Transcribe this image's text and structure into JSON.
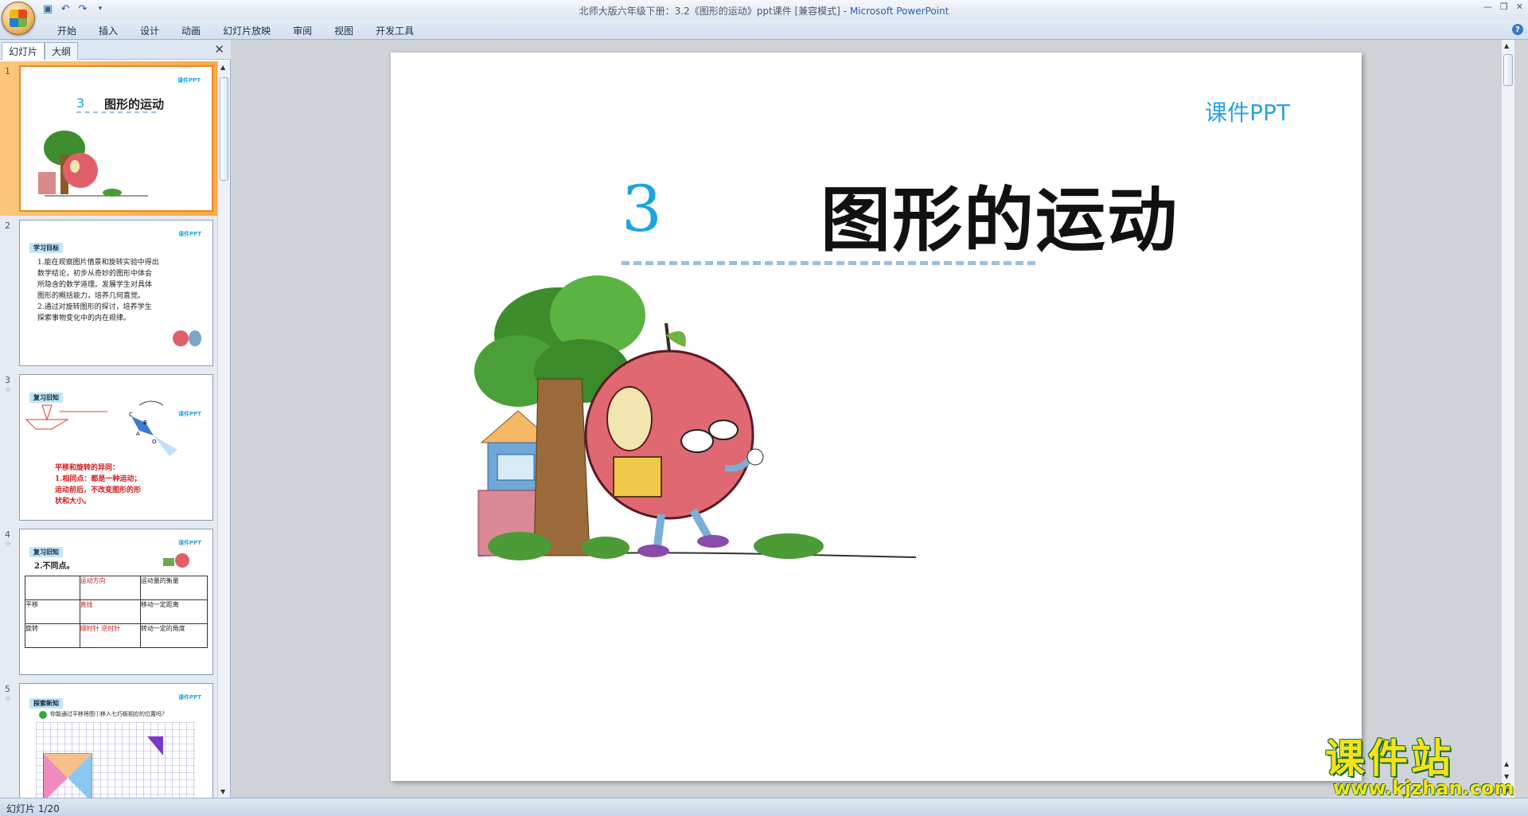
{
  "titlebar": {
    "document_title": "北师大版六年级下册：3.2《图形的运动》ppt课件 [兼容模式] - ",
    "app_name": "Microsoft PowerPoint"
  },
  "ribbon": {
    "tabs": [
      "开始",
      "插入",
      "设计",
      "动画",
      "幻灯片放映",
      "审阅",
      "视图",
      "开发工具"
    ]
  },
  "left_pane": {
    "tab_slides": "幻灯片",
    "tab_outline": "大纲",
    "thumbnails": [
      {
        "number": "1",
        "logo": "课件PPT",
        "num": "3",
        "title": "图形的运动"
      },
      {
        "number": "2",
        "logo": "课件PPT",
        "tag": "学习目标",
        "lines": [
          "1.能在观察图片情景和旋转实验中得出",
          "数学结论，初步从奇妙的图形中体会",
          "所隐含的数学道理。发展学生对具体",
          "图形的概括能力，培养几何直觉。",
          "2.通过对旋转图形的探讨，培养学生",
          "探索事物变化中的内在规律。"
        ]
      },
      {
        "number": "3",
        "logo": "课件PPT",
        "tag": "复习旧知",
        "label_c": "C",
        "label_b": "B",
        "label_a": "A",
        "label_o": "O",
        "red_lines": [
          "平移和旋转的异同：",
          "1.相同点：都是一种运动；",
          "运动前后，不改变图形的形",
          "状和大小。"
        ]
      },
      {
        "number": "4",
        "logo": "课件PPT",
        "tag": "复习旧知",
        "subtitle": "2.不同点。",
        "table": [
          [
            "",
            "运动方向",
            "运动量的衡量"
          ],
          [
            "平移",
            "直线",
            "移动一定距离"
          ],
          [
            "旋转",
            "顺时针 逆时针",
            "转动一定的角度"
          ]
        ]
      },
      {
        "number": "5",
        "logo": "课件PPT",
        "tag": "探索新知",
        "question": "你能通过平移将图①移入七巧板相应的位置吗?"
      }
    ]
  },
  "slide": {
    "logo": "课件PPT",
    "chapter_number": "3",
    "chapter_title": "图形的运动"
  },
  "watermark": {
    "text_cn": "课件站",
    "url": "www.kjzhan.com"
  },
  "statusbar": {
    "text": "幻灯片 1/20"
  }
}
